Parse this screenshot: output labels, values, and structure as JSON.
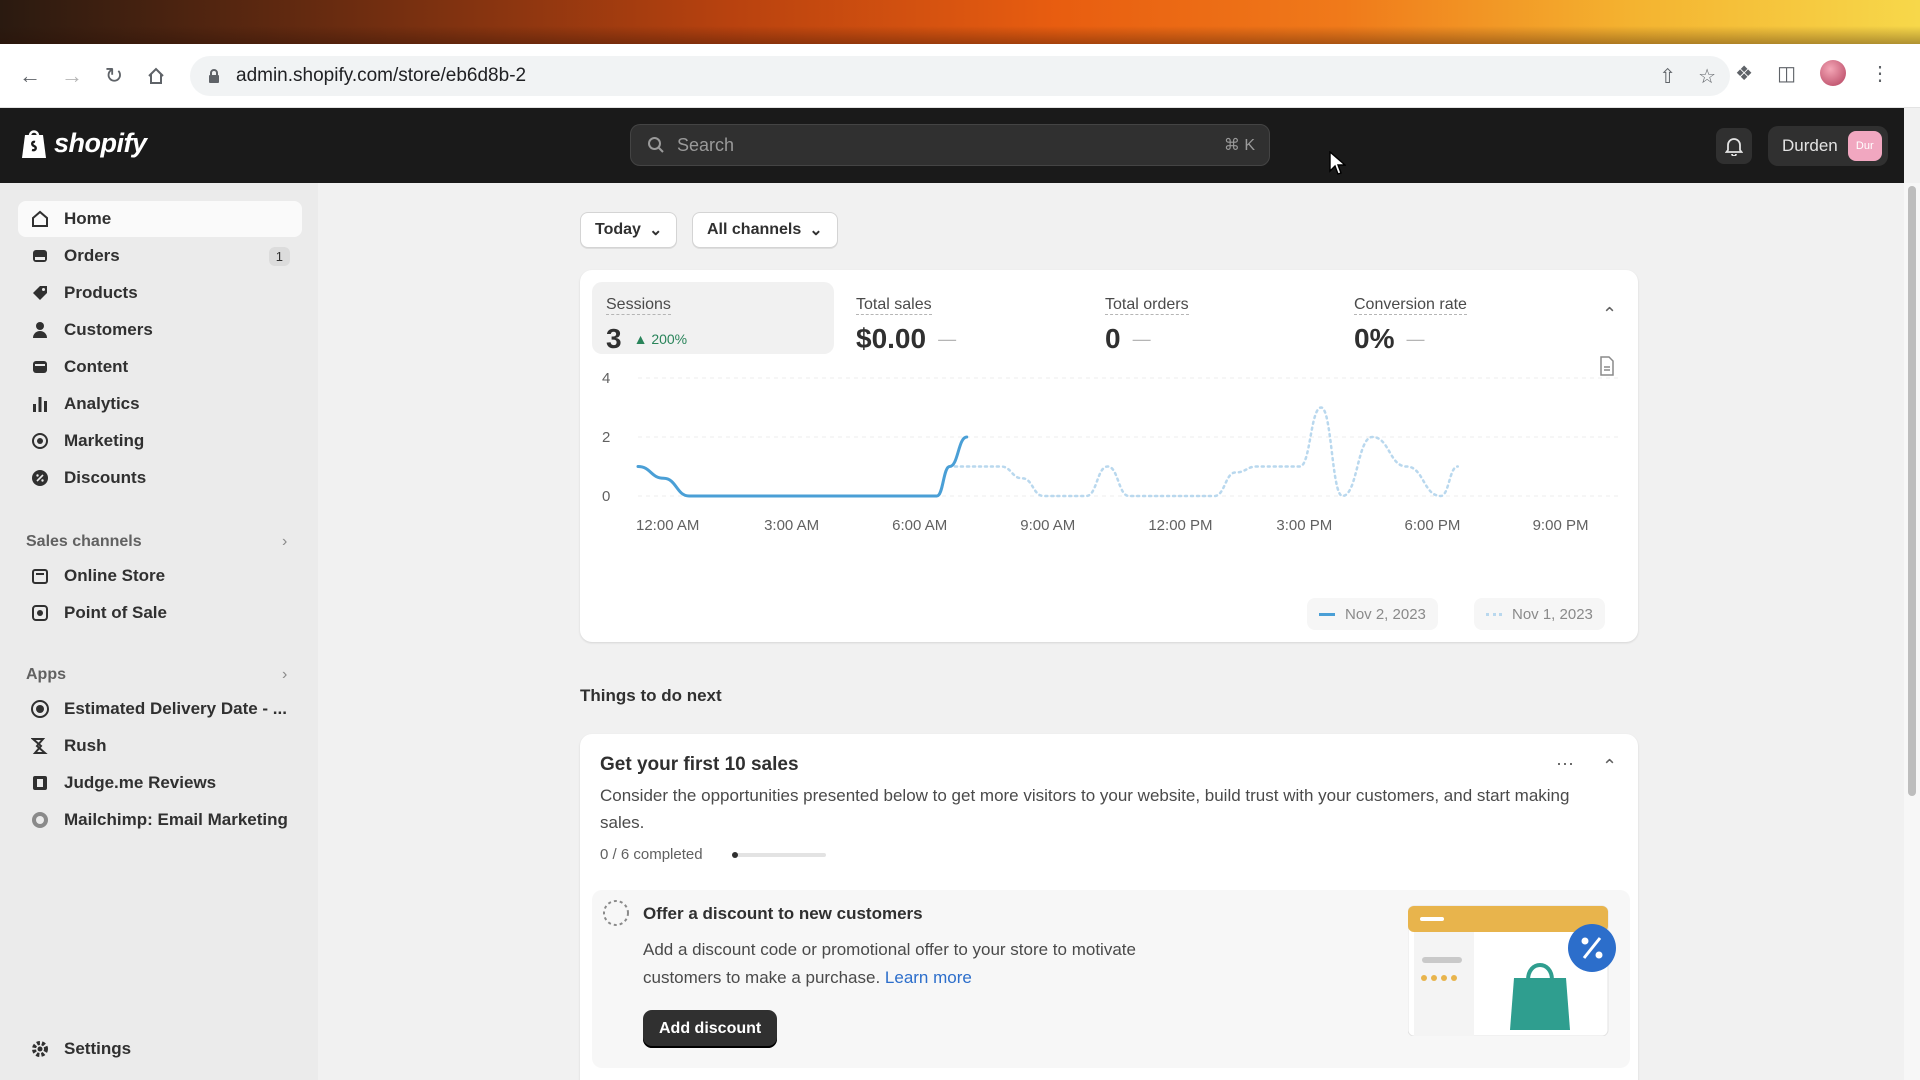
{
  "browser": {
    "url": "admin.shopify.com/store/eb6d8b-2"
  },
  "topbar": {
    "brand": "shopify",
    "search_placeholder": "Search",
    "search_shortcut": "⌘ K",
    "user_name": "Durden",
    "user_initials": "Dur"
  },
  "sidebar": {
    "items": [
      {
        "label": "Home",
        "icon": "home-icon"
      },
      {
        "label": "Orders",
        "icon": "orders-icon",
        "badge": "1"
      },
      {
        "label": "Products",
        "icon": "tag-icon"
      },
      {
        "label": "Customers",
        "icon": "person-icon"
      },
      {
        "label": "Content",
        "icon": "content-icon"
      },
      {
        "label": "Analytics",
        "icon": "bar-chart-icon"
      },
      {
        "label": "Marketing",
        "icon": "target-icon"
      },
      {
        "label": "Discounts",
        "icon": "discount-icon"
      }
    ],
    "sales_channels_label": "Sales channels",
    "sales_channels": [
      {
        "label": "Online Store",
        "icon": "store-icon"
      },
      {
        "label": "Point of Sale",
        "icon": "pos-icon"
      }
    ],
    "apps_label": "Apps",
    "apps": [
      {
        "label": "Estimated Delivery Date - ...",
        "icon": "app-icon"
      },
      {
        "label": "Rush",
        "icon": "rush-icon"
      },
      {
        "label": "Judge.me Reviews",
        "icon": "judgeme-icon"
      },
      {
        "label": "Mailchimp: Email Marketing",
        "icon": "mailchimp-icon"
      }
    ],
    "settings_label": "Settings"
  },
  "filters": {
    "date": "Today",
    "channels": "All channels"
  },
  "metrics": [
    {
      "label": "Sessions",
      "value": "3",
      "trend": "200%"
    },
    {
      "label": "Total sales",
      "value": "$0.00",
      "trend": "—"
    },
    {
      "label": "Total orders",
      "value": "0",
      "trend": "—"
    },
    {
      "label": "Conversion rate",
      "value": "0%",
      "trend": "—"
    }
  ],
  "chart_data": {
    "type": "line",
    "x": [
      "12:00 AM",
      "3:00 AM",
      "6:00 AM",
      "9:00 AM",
      "12:00 PM",
      "3:00 PM",
      "6:00 PM",
      "9:00 PM"
    ],
    "yticks": [
      0,
      2,
      4
    ],
    "ylim": [
      0,
      4
    ],
    "xlim": [
      0,
      23
    ],
    "grid": true,
    "series": [
      {
        "name": "Nov 2, 2023",
        "style": "solid",
        "color": "#4a9fd6",
        "points": [
          [
            0,
            1.0
          ],
          [
            0.6,
            0.6
          ],
          [
            1.2,
            0.0
          ],
          [
            2,
            0
          ],
          [
            3,
            0
          ],
          [
            4,
            0
          ],
          [
            5,
            0
          ],
          [
            6,
            0
          ],
          [
            7,
            0
          ],
          [
            7.3,
            1.0
          ],
          [
            7.7,
            2.0
          ]
        ]
      },
      {
        "name": "Nov 1, 2023",
        "style": "dotted",
        "color": "#b9d8ee",
        "points": [
          [
            0,
            1.0
          ],
          [
            0.6,
            0.6
          ],
          [
            1.2,
            0.0
          ],
          [
            2,
            0
          ],
          [
            3,
            0
          ],
          [
            4,
            0
          ],
          [
            5,
            0
          ],
          [
            6,
            0
          ],
          [
            7,
            0
          ],
          [
            7.3,
            1.0
          ],
          [
            7.7,
            1.0
          ],
          [
            8.5,
            1.0
          ],
          [
            9,
            0.6
          ],
          [
            9.5,
            0
          ],
          [
            10.5,
            0
          ],
          [
            11,
            1.0
          ],
          [
            11.5,
            0
          ],
          [
            13.5,
            0
          ],
          [
            14,
            0.8
          ],
          [
            14.5,
            1.0
          ],
          [
            15.5,
            1.0
          ],
          [
            16,
            3.0
          ],
          [
            16.5,
            0
          ],
          [
            17.2,
            2.0
          ],
          [
            18,
            1.0
          ],
          [
            18.8,
            0
          ],
          [
            19.2,
            1.0
          ]
        ]
      }
    ]
  },
  "todo": {
    "section_title": "Things to do next",
    "card_title": "Get your first 10 sales",
    "card_desc": "Consider the opportunities presented below to get more visitors to your website, build trust with your customers, and start making sales.",
    "progress_text": "0 / 6 completed",
    "progress_fraction": 0.0,
    "task_title": "Offer a discount to new customers",
    "task_desc": "Add a discount code or promotional offer to your store to motivate customers to make a purchase.",
    "learn_more": "Learn more",
    "button": "Add discount"
  }
}
